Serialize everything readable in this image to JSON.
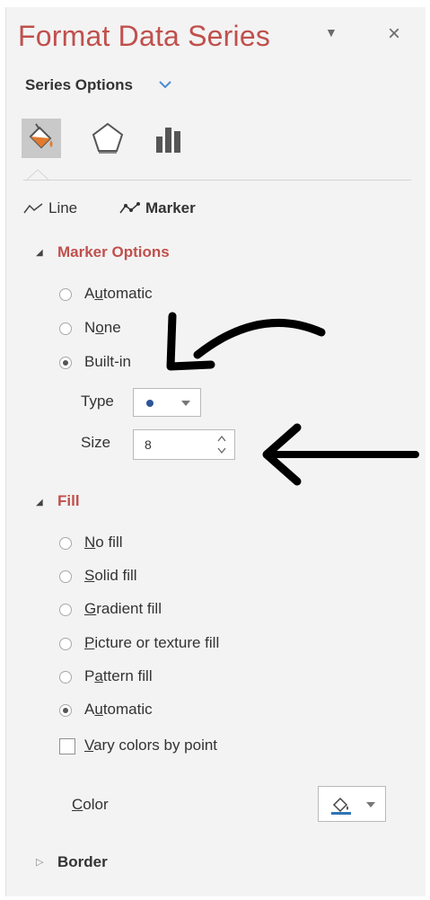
{
  "panel": {
    "title": "Format Data Series",
    "pin_icon": "chevron-down-icon",
    "close_icon": "close-icon",
    "close_glyph": "×",
    "pin_glyph": "▼"
  },
  "series_options": {
    "label": "Series Options"
  },
  "category_icons": [
    "fill-line-icon",
    "effects-pentagon-icon",
    "series-options-bars-icon"
  ],
  "tabs": [
    {
      "label": "Line",
      "icon": "line-icon"
    },
    {
      "label": "Marker",
      "icon": "marker-icon"
    }
  ],
  "marker_options": {
    "header": "Marker Options",
    "options": [
      {
        "pre": "A",
        "u": "u",
        "post": "tomatic",
        "selected": false
      },
      {
        "pre": "N",
        "u": "o",
        "post": "ne",
        "selected": false
      },
      {
        "pre": "Built-in",
        "u": "",
        "post": "",
        "selected": true
      }
    ],
    "type_label": "Type",
    "size_label": "Size",
    "size_value": "8"
  },
  "fill": {
    "header": "Fill",
    "options": [
      {
        "pre": "",
        "u": "N",
        "post": "o fill",
        "selected": false
      },
      {
        "pre": "",
        "u": "S",
        "post": "olid fill",
        "selected": false
      },
      {
        "pre": "",
        "u": "G",
        "post": "radient fill",
        "selected": false
      },
      {
        "pre": "",
        "u": "P",
        "post": "icture or texture fill",
        "selected": false
      },
      {
        "pre": "P",
        "u": "a",
        "post": "ttern fill",
        "selected": false
      },
      {
        "pre": "A",
        "u": "u",
        "post": "tomatic",
        "selected": true
      }
    ],
    "vary_pre": "",
    "vary_u": "V",
    "vary_post": "ary colors by point",
    "color_pre": "",
    "color_u": "C",
    "color_post": "olor"
  },
  "border": {
    "header": "Border"
  },
  "colors": {
    "accent_red": "#c0504d",
    "marker_blue": "#2e5597"
  }
}
